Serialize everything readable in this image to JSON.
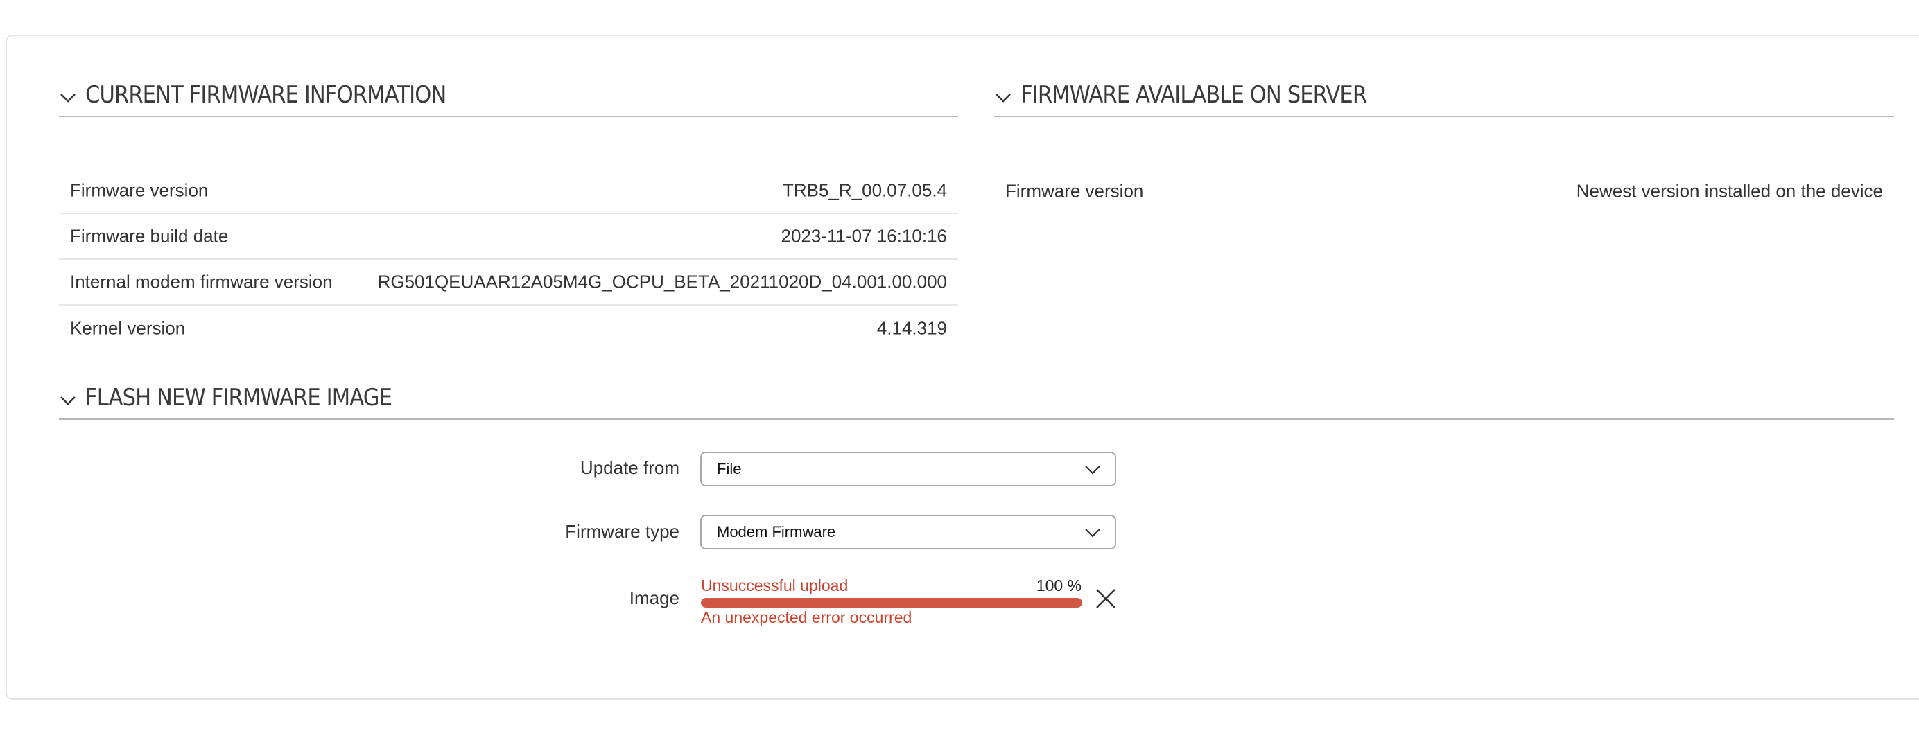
{
  "current_firmware": {
    "title": "CURRENT FIRMWARE INFORMATION",
    "rows": [
      {
        "label": "Firmware version",
        "value": "TRB5_R_00.07.05.4"
      },
      {
        "label": "Firmware build date",
        "value": "2023-11-07 16:10:16"
      },
      {
        "label": "Internal modem firmware version",
        "value": "RG501QEUAAR12A05M4G_OCPU_BETA_20211020D_04.001.00.000"
      },
      {
        "label": "Kernel version",
        "value": "4.14.319"
      }
    ]
  },
  "server_firmware": {
    "title": "FIRMWARE AVAILABLE ON SERVER",
    "rows": [
      {
        "label": "Firmware version",
        "value": "Newest version installed on the device"
      }
    ]
  },
  "flash": {
    "title": "FLASH NEW FIRMWARE IMAGE",
    "update_from": {
      "label": "Update from",
      "value": "File"
    },
    "firmware_type": {
      "label": "Firmware type",
      "value": "Modem Firmware"
    },
    "image": {
      "label": "Image",
      "status": "Unsuccessful upload",
      "percent_text": "100 %",
      "progress": 1.0,
      "error": "An unexpected error occurred"
    }
  },
  "icons": {
    "section_toggle": "chevron-down-icon",
    "select_arrow": "chevron-down-icon",
    "remove": "close-icon"
  },
  "colors": {
    "error": "#c9432f",
    "progress_fill": "#d15745",
    "divider": "#b8b8b8"
  }
}
